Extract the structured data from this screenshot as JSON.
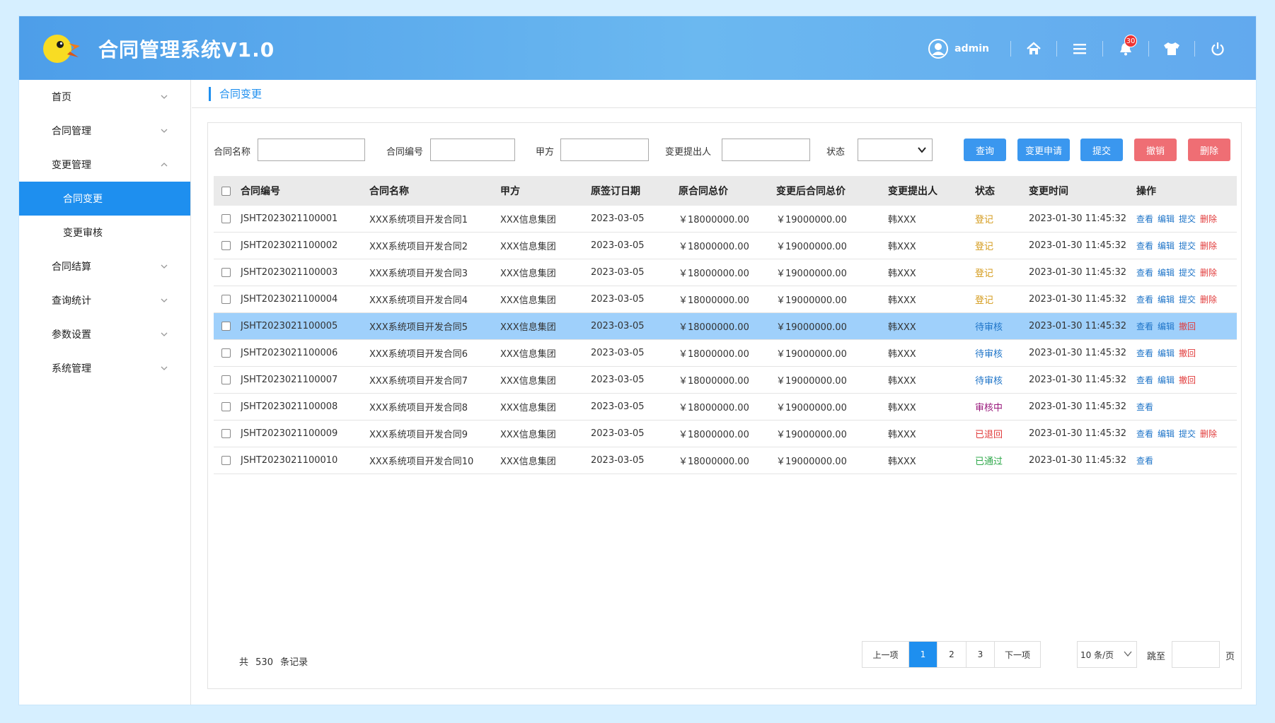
{
  "app": {
    "title": "合同管理系统V1.0"
  },
  "header": {
    "username": "admin",
    "bell_count": "30"
  },
  "sidebar": {
    "items": [
      {
        "label": "首页",
        "expanded": false
      },
      {
        "label": "合同管理",
        "expanded": false
      },
      {
        "label": "变更管理",
        "expanded": true
      },
      {
        "label": "合同结算",
        "expanded": false
      },
      {
        "label": "查询统计",
        "expanded": false
      },
      {
        "label": "参数设置",
        "expanded": false
      },
      {
        "label": "系统管理",
        "expanded": false
      }
    ],
    "subitems": [
      {
        "label": "合同变更",
        "active": true
      },
      {
        "label": "变更审核",
        "active": false
      }
    ]
  },
  "breadcrumb": {
    "current": "合同变更"
  },
  "filters": {
    "contract_name_label": "合同名称",
    "contract_no_label": "合同编号",
    "party_a_label": "甲方",
    "proposer_label": "变更提出人",
    "status_label": "状态",
    "contract_name_value": "",
    "contract_no_value": "",
    "party_a_value": "",
    "proposer_value": "",
    "status_value": ""
  },
  "buttons": {
    "query": "查询",
    "change_request": "变更申请",
    "submit": "提交",
    "revoke": "撤销",
    "delete": "删除"
  },
  "table": {
    "headers": [
      "合同编号",
      "合同名称",
      "甲方",
      "原签订日期",
      "原合同总价",
      "变更后合同总价",
      "变更提出人",
      "状态",
      "变更时间",
      "操作"
    ],
    "rows": [
      {
        "no": "JSHT2023021100001",
        "name": "XXX系统项目开发合同1",
        "party": "XXX信息集团",
        "date": "2023-03-05",
        "orig": "￥18000000.00",
        "new": "￥19000000.00",
        "proposer": "韩XXX",
        "status": "登记",
        "status_class": "dengji",
        "time": "2023-01-30 11:45:32",
        "ops": [
          "查看",
          "编辑",
          "提交",
          "删除"
        ]
      },
      {
        "no": "JSHT2023021100002",
        "name": "XXX系统项目开发合同2",
        "party": "XXX信息集团",
        "date": "2023-03-05",
        "orig": "￥18000000.00",
        "new": "￥19000000.00",
        "proposer": "韩XXX",
        "status": "登记",
        "status_class": "dengji",
        "time": "2023-01-30 11:45:32",
        "ops": [
          "查看",
          "编辑",
          "提交",
          "删除"
        ]
      },
      {
        "no": "JSHT2023021100003",
        "name": "XXX系统项目开发合同3",
        "party": "XXX信息集团",
        "date": "2023-03-05",
        "orig": "￥18000000.00",
        "new": "￥19000000.00",
        "proposer": "韩XXX",
        "status": "登记",
        "status_class": "dengji",
        "time": "2023-01-30 11:45:32",
        "ops": [
          "查看",
          "编辑",
          "提交",
          "删除"
        ]
      },
      {
        "no": "JSHT2023021100004",
        "name": "XXX系统项目开发合同4",
        "party": "XXX信息集团",
        "date": "2023-03-05",
        "orig": "￥18000000.00",
        "new": "￥19000000.00",
        "proposer": "韩XXX",
        "status": "登记",
        "status_class": "dengji",
        "time": "2023-01-30 11:45:32",
        "ops": [
          "查看",
          "编辑",
          "提交",
          "删除"
        ]
      },
      {
        "no": "JSHT2023021100005",
        "name": "XXX系统项目开发合同5",
        "party": "XXX信息集团",
        "date": "2023-03-05",
        "orig": "￥18000000.00",
        "new": "￥19000000.00",
        "proposer": "韩XXX",
        "status": "待审核",
        "status_class": "daishen",
        "time": "2023-01-30 11:45:32",
        "ops": [
          "查看",
          "编辑",
          "撤回"
        ],
        "selected": true
      },
      {
        "no": "JSHT2023021100006",
        "name": "XXX系统项目开发合同6",
        "party": "XXX信息集团",
        "date": "2023-03-05",
        "orig": "￥18000000.00",
        "new": "￥19000000.00",
        "proposer": "韩XXX",
        "status": "待审核",
        "status_class": "daishen",
        "time": "2023-01-30 11:45:32",
        "ops": [
          "查看",
          "编辑",
          "撤回"
        ]
      },
      {
        "no": "JSHT2023021100007",
        "name": "XXX系统项目开发合同7",
        "party": "XXX信息集团",
        "date": "2023-03-05",
        "orig": "￥18000000.00",
        "new": "￥19000000.00",
        "proposer": "韩XXX",
        "status": "待审核",
        "status_class": "daishen",
        "time": "2023-01-30 11:45:32",
        "ops": [
          "查看",
          "编辑",
          "撤回"
        ]
      },
      {
        "no": "JSHT2023021100008",
        "name": "XXX系统项目开发合同8",
        "party": "XXX信息集团",
        "date": "2023-03-05",
        "orig": "￥18000000.00",
        "new": "￥19000000.00",
        "proposer": "韩XXX",
        "status": "审核中",
        "status_class": "shenhe",
        "time": "2023-01-30 11:45:32",
        "ops": [
          "查看"
        ]
      },
      {
        "no": "JSHT2023021100009",
        "name": "XXX系统项目开发合同9",
        "party": "XXX信息集团",
        "date": "2023-03-05",
        "orig": "￥18000000.00",
        "new": "￥19000000.00",
        "proposer": "韩XXX",
        "status": "已退回",
        "status_class": "tuihui",
        "time": "2023-01-30 11:45:32",
        "ops": [
          "查看",
          "编辑",
          "提交",
          "删除"
        ]
      },
      {
        "no": "JSHT2023021100010",
        "name": "XXX系统项目开发合同10",
        "party": "XXX信息集团",
        "date": "2023-03-05",
        "orig": "￥18000000.00",
        "new": "￥19000000.00",
        "proposer": "韩XXX",
        "status": "已通过",
        "status_class": "tongguo",
        "time": "2023-01-30 11:45:32",
        "ops": [
          "查看"
        ]
      }
    ]
  },
  "footer": {
    "total_prefix": "共",
    "total_count": "530",
    "total_suffix": "条记录",
    "prev": "上一项",
    "pages": [
      "1",
      "2",
      "3"
    ],
    "current_page": "1",
    "next": "下一项",
    "page_size": "10 条/页",
    "jump_label": "跳至",
    "jump_value": "",
    "page_unit": "页"
  },
  "colors": {
    "accent": "#1e8fef",
    "selected_row": "#9fd0fb",
    "danger": "#ef6e74"
  }
}
